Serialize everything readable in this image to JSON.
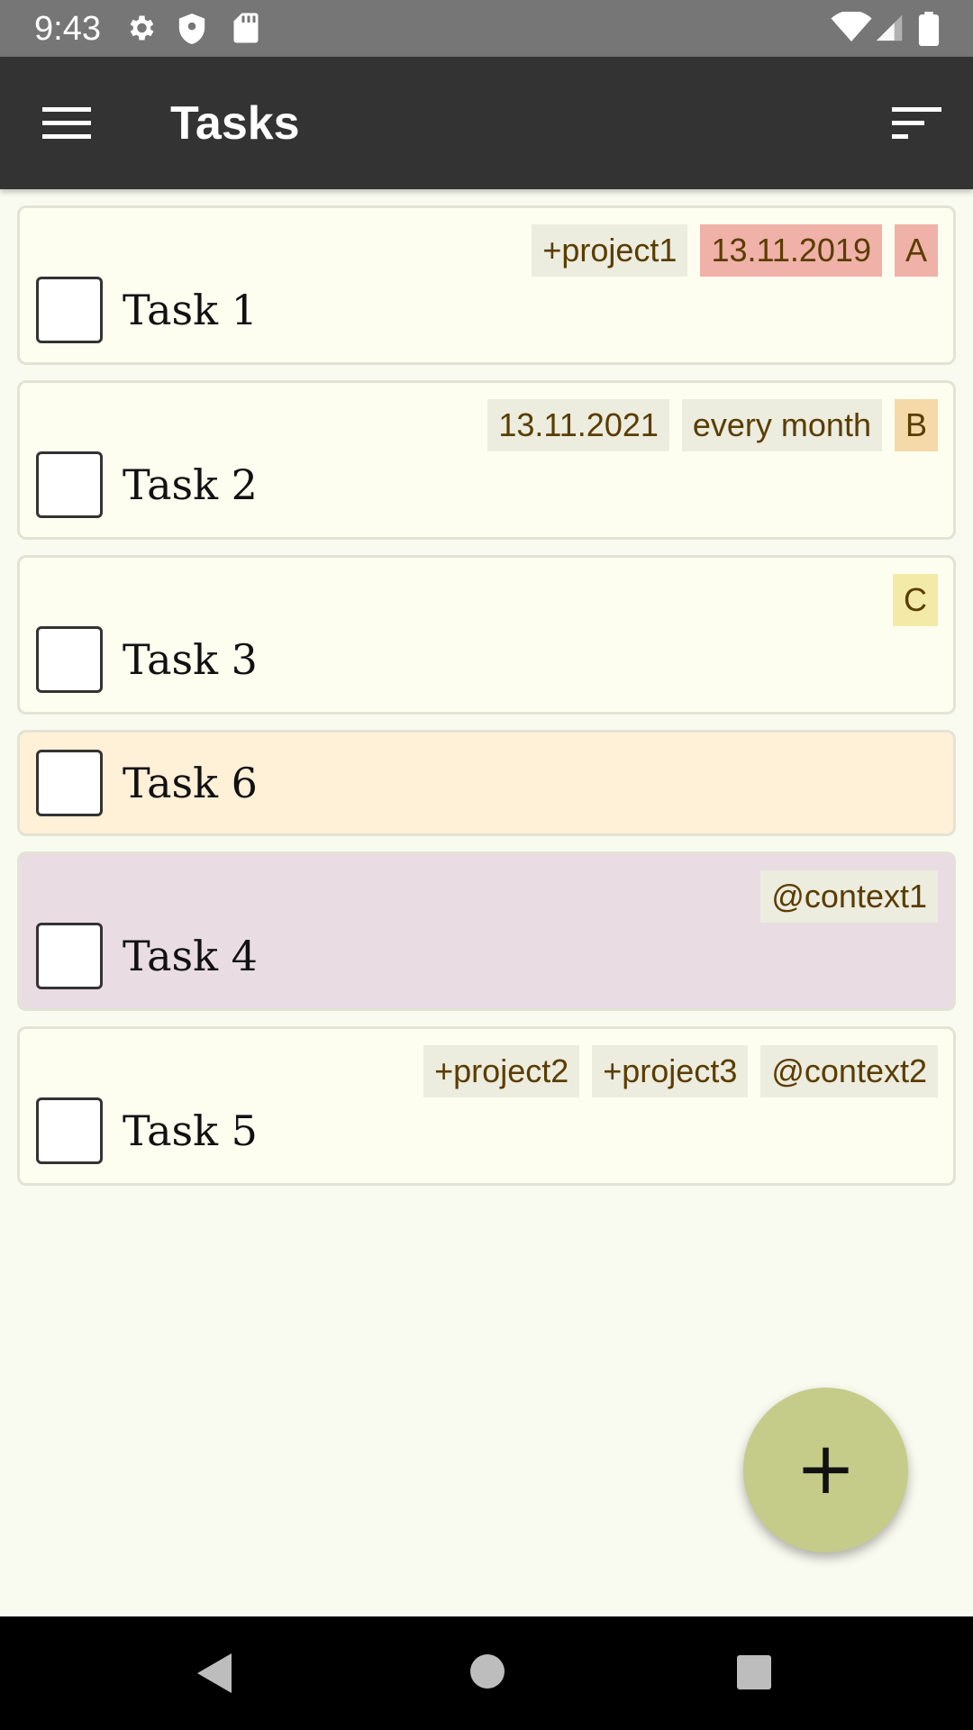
{
  "status_bar": {
    "time": "9:43",
    "left_icons": [
      "gear-icon",
      "shield-icon",
      "sd-card-icon"
    ],
    "right_icons": [
      "wifi-icon",
      "signal-icon",
      "battery-icon"
    ]
  },
  "app_bar": {
    "title": "Tasks",
    "menu_icon": "hamburger-menu-icon",
    "sort_icon": "sort-icon"
  },
  "tasks": [
    {
      "text": "Task 1",
      "checked": false,
      "background": "#fdfef0",
      "tags": [
        {
          "label": "+project1",
          "bg": "#ececdf"
        },
        {
          "label": "13.11.2019",
          "bg": "#f0b1a8"
        },
        {
          "label": "A",
          "bg": "#f0b1a8"
        }
      ]
    },
    {
      "text": "Task 2",
      "checked": false,
      "background": "#fdfef0",
      "tags": [
        {
          "label": "13.11.2021",
          "bg": "#ececdf"
        },
        {
          "label": "every month",
          "bg": "#ececdf"
        },
        {
          "label": "B",
          "bg": "#f5d9a8"
        }
      ]
    },
    {
      "text": "Task 3",
      "checked": false,
      "background": "#fdfef0",
      "tags": [
        {
          "label": "C",
          "bg": "#f3eaa8"
        }
      ]
    },
    {
      "text": "Task 6",
      "checked": false,
      "background": "#fff0d8",
      "tags": []
    },
    {
      "text": "Task 4",
      "checked": false,
      "background": "#e9dce3",
      "tags": [
        {
          "label": "@context1",
          "bg": "#ececdf"
        }
      ]
    },
    {
      "text": "Task 5",
      "checked": false,
      "background": "#fdfef0",
      "tags": [
        {
          "label": "+project2",
          "bg": "#ececdf"
        },
        {
          "label": "+project3",
          "bg": "#ececdf"
        },
        {
          "label": "@context2",
          "bg": "#ececdf"
        }
      ]
    }
  ],
  "fab": {
    "label": "+",
    "icon": "add-icon",
    "color": "#c5cc8a"
  },
  "nav_bar": {
    "icons": [
      "back-icon",
      "home-icon",
      "recents-icon"
    ]
  },
  "colors": {
    "app_bar": "#333333",
    "status_bar": "#767676",
    "page_background": "#fafbf0",
    "tag_text": "#5a3d00"
  }
}
